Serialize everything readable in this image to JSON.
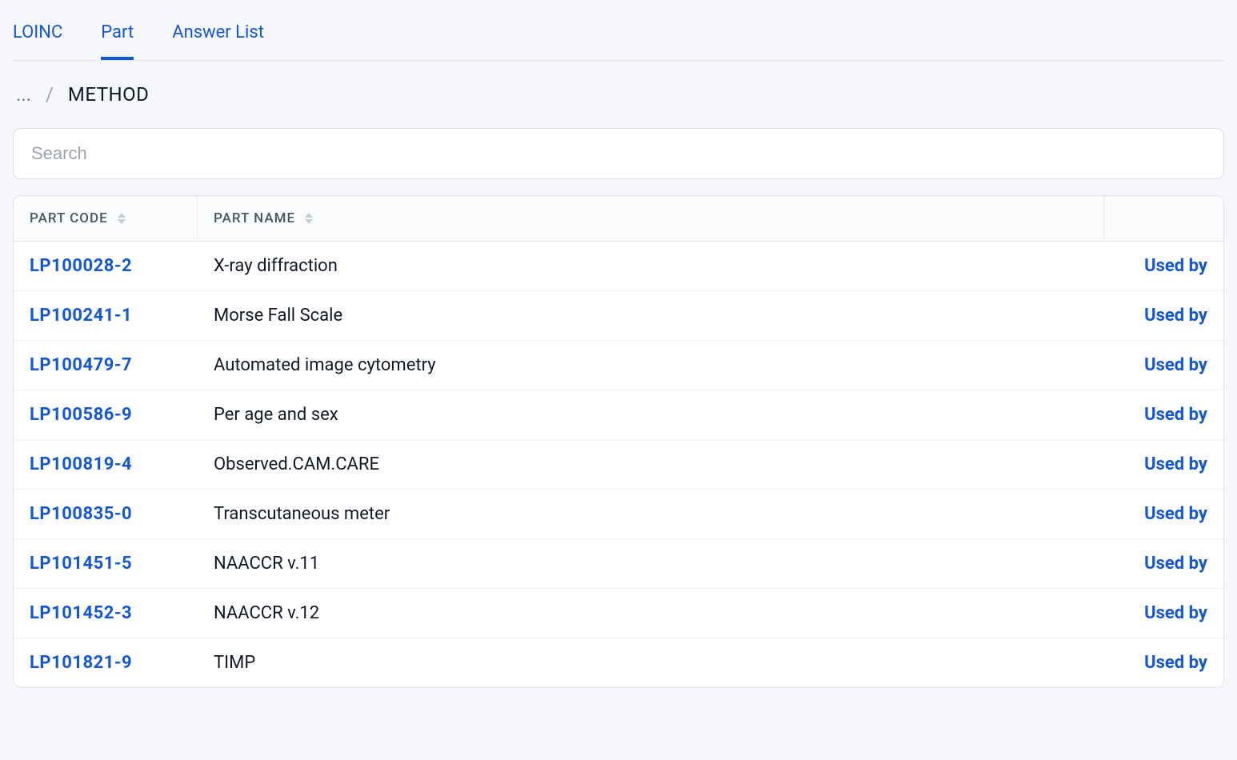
{
  "tabs": [
    {
      "label": "LOINC",
      "active": false
    },
    {
      "label": "Part",
      "active": true
    },
    {
      "label": "Answer List",
      "active": false
    }
  ],
  "breadcrumb": {
    "ellipsis": "...",
    "separator": "/",
    "current": "METHOD"
  },
  "search": {
    "placeholder": "Search",
    "value": ""
  },
  "table": {
    "headers": {
      "code": "PART CODE",
      "name": "PART NAME"
    },
    "action_label": "Used by",
    "rows": [
      {
        "code": "LP100028-2",
        "name": "X-ray diffraction"
      },
      {
        "code": "LP100241-1",
        "name": "Morse Fall Scale"
      },
      {
        "code": "LP100479-7",
        "name": "Automated image cytometry"
      },
      {
        "code": "LP100586-9",
        "name": "Per age and sex"
      },
      {
        "code": "LP100819-4",
        "name": "Observed.CAM.CARE"
      },
      {
        "code": "LP100835-0",
        "name": "Transcutaneous meter"
      },
      {
        "code": "LP101451-5",
        "name": "NAACCR v.11"
      },
      {
        "code": "LP101452-3",
        "name": "NAACCR v.12"
      },
      {
        "code": "LP101821-9",
        "name": "TIMP"
      }
    ]
  }
}
